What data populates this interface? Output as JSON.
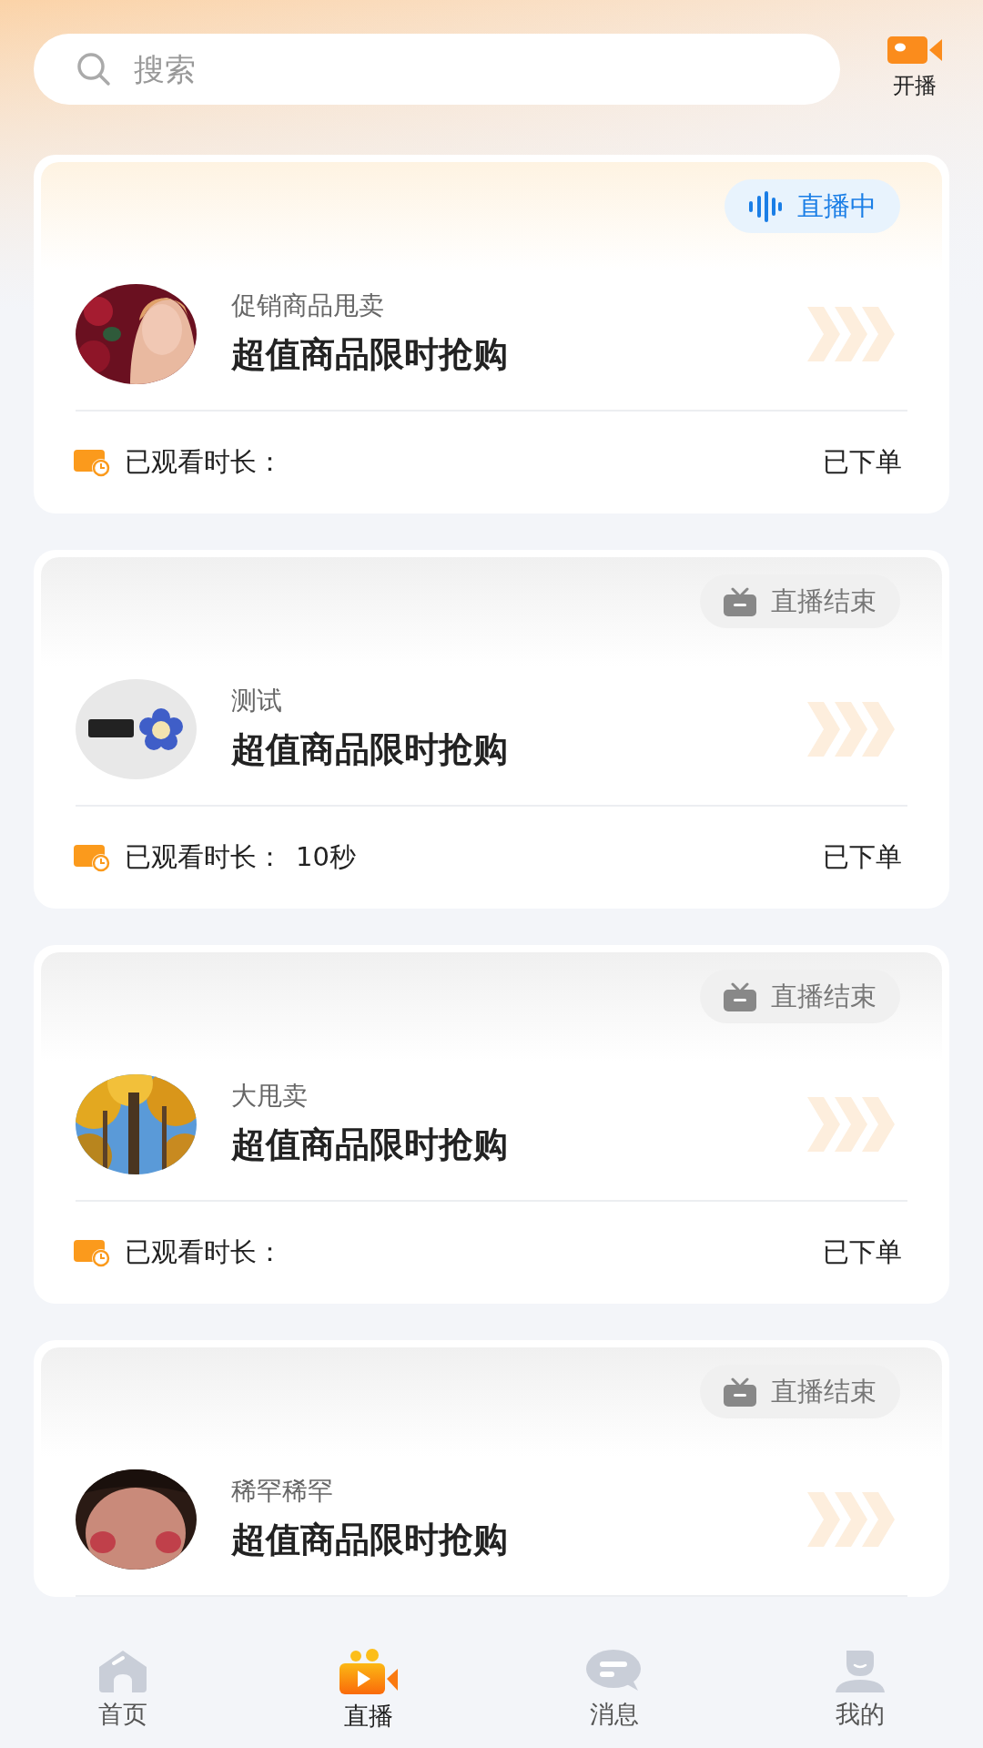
{
  "search": {
    "placeholder": "搜索"
  },
  "go_live": {
    "label": "开播"
  },
  "cards": [
    {
      "status": {
        "kind": "live",
        "text": "直播中"
      },
      "subtitle": "促销商品甩卖",
      "title": "超值商品限时抢购",
      "footer": {
        "label": "已观看时长：",
        "order": "已下单"
      }
    },
    {
      "status": {
        "kind": "ended",
        "text": "直播结束"
      },
      "subtitle": "测试",
      "title": "超值商品限时抢购",
      "footer": {
        "label": "已观看时长：",
        "value": "10秒",
        "order": "已下单"
      }
    },
    {
      "status": {
        "kind": "ended",
        "text": "直播结束"
      },
      "subtitle": "大甩卖",
      "title": "超值商品限时抢购",
      "footer": {
        "label": "已观看时长：",
        "order": "已下单"
      }
    },
    {
      "status": {
        "kind": "ended",
        "text": "直播结束"
      },
      "subtitle": "稀罕稀罕",
      "title": "超值商品限时抢购"
    }
  ],
  "tabbar": [
    {
      "label": "首页",
      "selected": false
    },
    {
      "label": "直播",
      "selected": true
    },
    {
      "label": "消息",
      "selected": false
    },
    {
      "label": "我的",
      "selected": false
    }
  ]
}
